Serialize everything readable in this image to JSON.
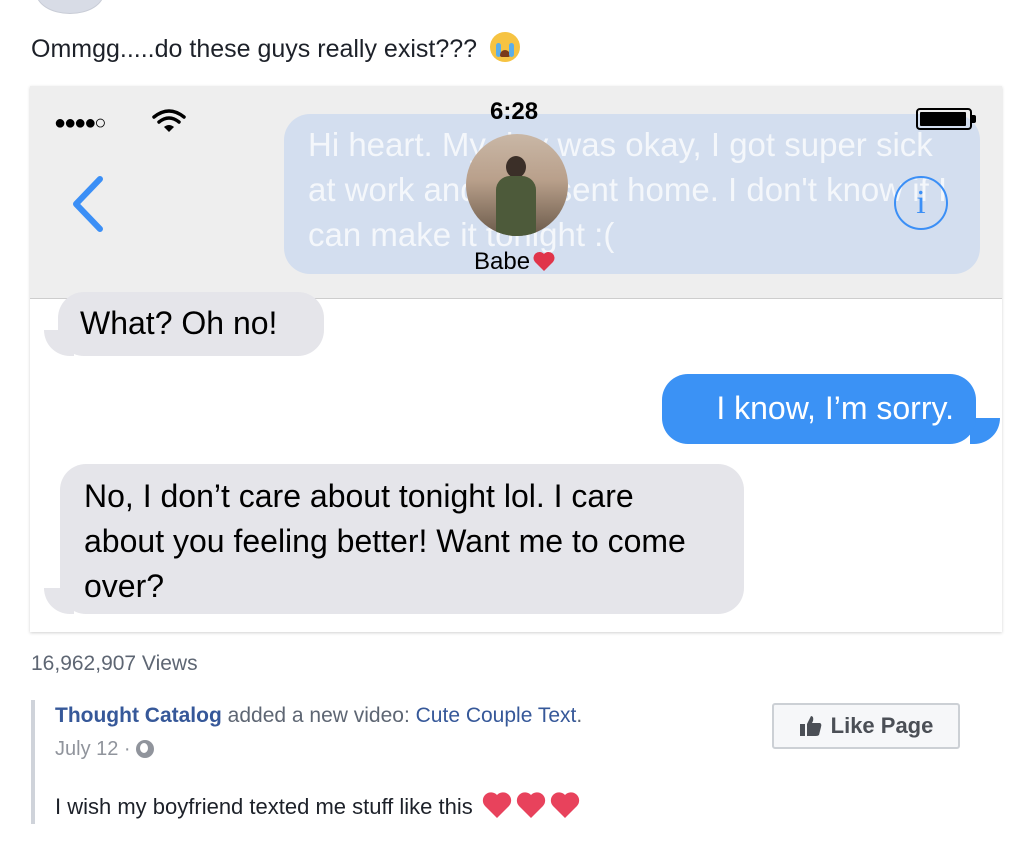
{
  "post": {
    "text": "Ommgg.....do these guys really exist???",
    "emoji": "crying-face-icon"
  },
  "video": {
    "status_time": "6:28",
    "contact_name": "Babe",
    "ghost_message": "Hi heart. My day was okay, I got super sick at work and was sent home. I don't know if I can make it tonight :(",
    "messages": [
      {
        "from": "them",
        "text": "What? Oh no!"
      },
      {
        "from": "me",
        "text": "I know, I’m sorry."
      },
      {
        "from": "them",
        "text": "No, I don’t care about tonight lol. I care about you feeling better! Want me to come over?"
      }
    ],
    "colors": {
      "incoming": "#e5e5ea",
      "outgoing": "#3b92f5",
      "ios_blue": "#3b8ff6"
    }
  },
  "views": "16,962,907 Views",
  "shared": {
    "page_name": "Thought Catalog",
    "added_text": "added a new video:",
    "video_title": "Cute Couple Text",
    "date": "July 12 ·",
    "like_button": "Like Page",
    "caption": "I wish my boyfriend texted me stuff like this"
  }
}
